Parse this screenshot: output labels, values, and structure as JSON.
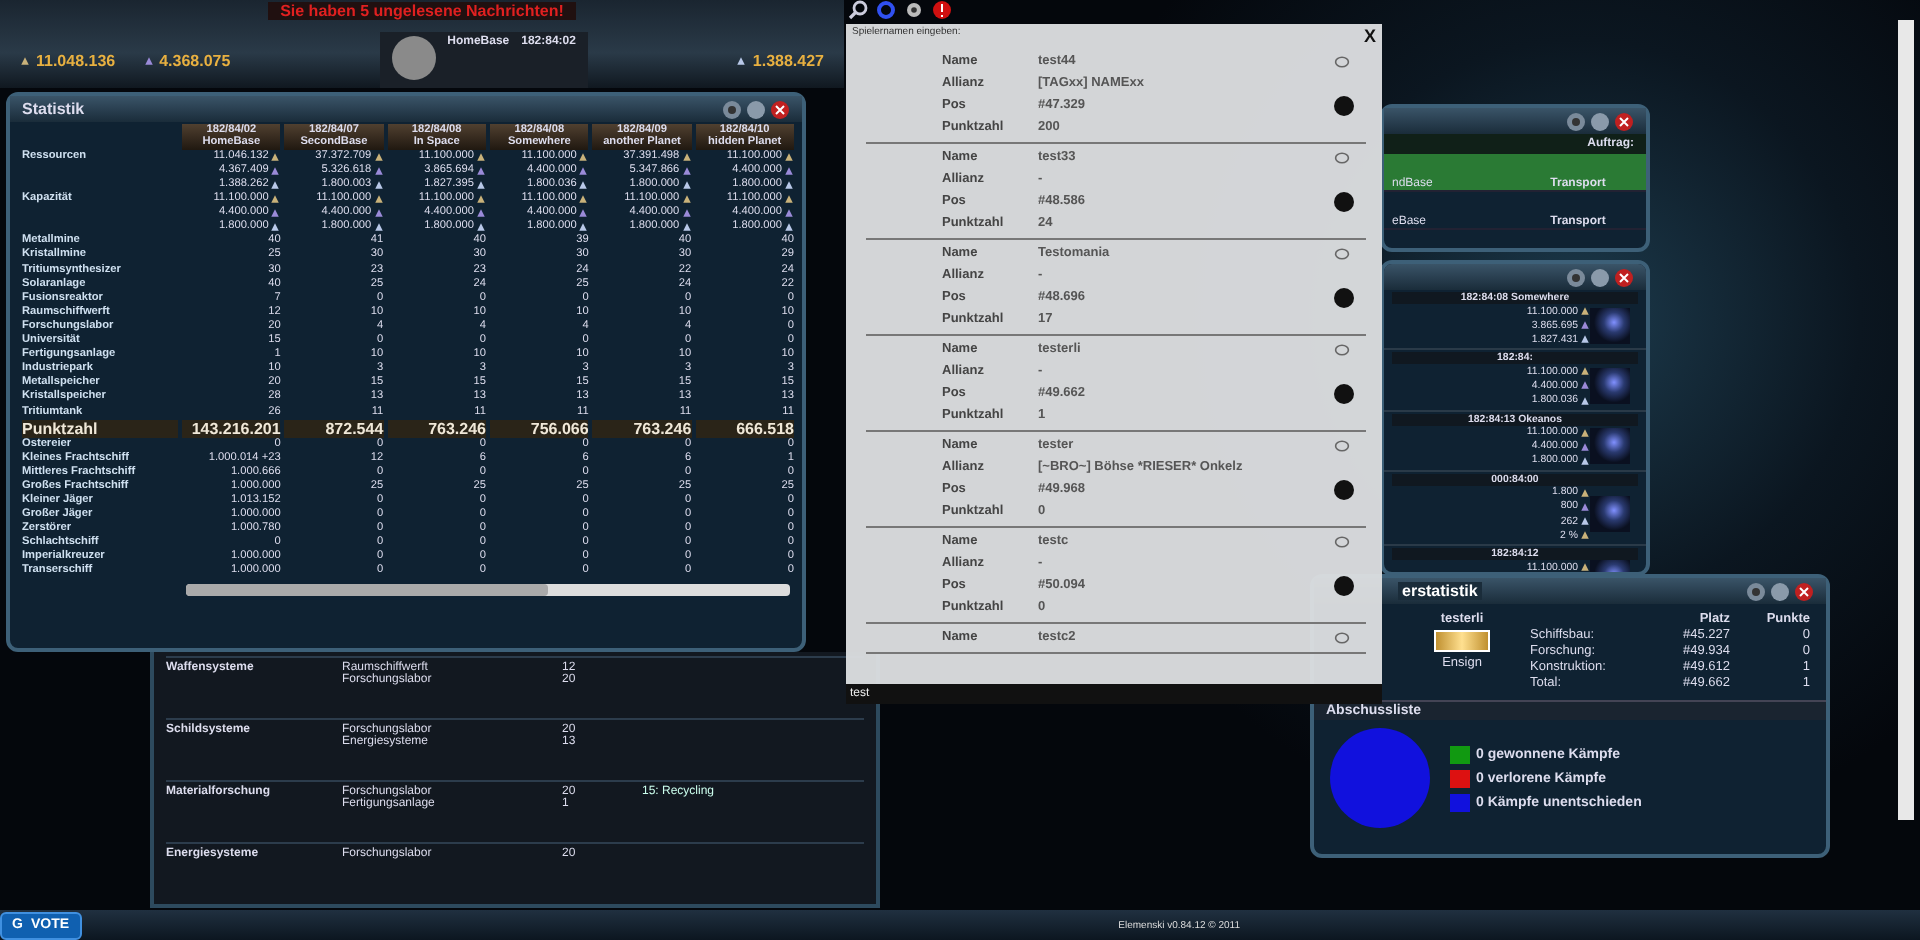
{
  "top_bar": {
    "message": "Sie haben 5 ungelesene Nachrichten!",
    "resources": [
      {
        "kind": "metal",
        "value": "11.048.136"
      },
      {
        "kind": "crystal",
        "value": "4.368.075"
      },
      {
        "kind": "tritium",
        "value": "1.388.427"
      }
    ],
    "planet": {
      "name": "HomeBase",
      "coords": "182:84:02"
    }
  },
  "statistik": {
    "title": "Statistik",
    "columns": [
      {
        "date": "182/84/02",
        "name": "HomeBase"
      },
      {
        "date": "182/84/07",
        "name": "SecondBase"
      },
      {
        "date": "182/84/08",
        "name": "In Space"
      },
      {
        "date": "182/84/08",
        "name": "Somewhere"
      },
      {
        "date": "182/84/09",
        "name": "another Planet"
      },
      {
        "date": "182/84/10",
        "name": "hidden Planet"
      }
    ],
    "resources": {
      "label": "Ressourcen",
      "rows": [
        [
          "11.046.132",
          "37.372.709",
          "11.100.000",
          "11.100.000",
          "37.391.498",
          "11.100.000"
        ],
        [
          "4.367.409",
          "5.326.618",
          "3.865.694",
          "4.400.000",
          "5.347.866",
          "4.400.000"
        ],
        [
          "1.388.262",
          "1.800.003",
          "1.827.395",
          "1.800.036",
          "1.800.000",
          "1.800.000"
        ]
      ]
    },
    "capacity": {
      "label": "Kapazität",
      "rows": [
        [
          "11.100.000",
          "11.100.000",
          "11.100.000",
          "11.100.000",
          "11.100.000",
          "11.100.000"
        ],
        [
          "4.400.000",
          "4.400.000",
          "4.400.000",
          "4.400.000",
          "4.400.000",
          "4.400.000"
        ],
        [
          "1.800.000",
          "1.800.000",
          "1.800.000",
          "1.800.000",
          "1.800.000",
          "1.800.000"
        ]
      ]
    },
    "buildings": [
      {
        "label": "Metallmine",
        "values": [
          "40",
          "41",
          "40",
          "39",
          "40",
          "40"
        ]
      },
      {
        "label": "Kristallmine",
        "values": [
          "25",
          "30",
          "30",
          "30",
          "30",
          "29"
        ]
      },
      {
        "label": "Tritiumsynthesizer",
        "values": [
          "30",
          "23",
          "23",
          "24",
          "22",
          "24"
        ]
      },
      {
        "label": "Solaranlage",
        "values": [
          "40",
          "25",
          "24",
          "25",
          "24",
          "22"
        ]
      },
      {
        "label": "Fusionsreaktor",
        "values": [
          "7",
          "0",
          "0",
          "0",
          "0",
          "0"
        ]
      },
      {
        "label": "Raumschiffwerft",
        "values": [
          "12",
          "10",
          "10",
          "10",
          "10",
          "10"
        ]
      },
      {
        "label": "Forschungslabor",
        "values": [
          "20",
          "4",
          "4",
          "4",
          "4",
          "0"
        ]
      },
      {
        "label": "Universität",
        "values": [
          "15",
          "0",
          "0",
          "0",
          "0",
          "0"
        ]
      },
      {
        "label": "Fertigungsanlage",
        "values": [
          "1",
          "10",
          "10",
          "10",
          "10",
          "10"
        ]
      },
      {
        "label": "Industriepark",
        "values": [
          "10",
          "3",
          "3",
          "3",
          "3",
          "3"
        ]
      },
      {
        "label": "Metallspeicher",
        "values": [
          "20",
          "15",
          "15",
          "15",
          "15",
          "15"
        ]
      },
      {
        "label": "Kristallspeicher",
        "values": [
          "28",
          "13",
          "13",
          "13",
          "13",
          "13"
        ]
      },
      {
        "label": "Tritiumtank",
        "values": [
          "26",
          "11",
          "11",
          "11",
          "11",
          "11"
        ]
      }
    ],
    "total": {
      "label": "Punktzahl",
      "values": [
        "143.216.201",
        "872.544",
        "763.246",
        "756.066",
        "763.246",
        "666.518"
      ]
    },
    "ships": [
      {
        "label": "Ostereier",
        "values": [
          "0",
          "0",
          "0",
          "0",
          "0",
          "0"
        ]
      },
      {
        "label": "Kleines Frachtschiff",
        "values": [
          "1.000.014 +23",
          "12",
          "6",
          "6",
          "6",
          "1"
        ]
      },
      {
        "label": "Mittleres Frachtschiff",
        "values": [
          "1.000.666",
          "0",
          "0",
          "0",
          "0",
          "0"
        ]
      },
      {
        "label": "Großes Frachtschiff",
        "values": [
          "1.000.000",
          "25",
          "25",
          "25",
          "25",
          "25"
        ]
      },
      {
        "label": "Kleiner Jäger",
        "values": [
          "1.013.152",
          "0",
          "0",
          "0",
          "0",
          "0"
        ]
      },
      {
        "label": "Großer Jäger",
        "values": [
          "1.000.000",
          "0",
          "0",
          "0",
          "0",
          "0"
        ]
      },
      {
        "label": "Zerstörer",
        "values": [
          "1.000.780",
          "0",
          "0",
          "0",
          "0",
          "0"
        ]
      },
      {
        "label": "Schlachtschiff",
        "values": [
          "0",
          "0",
          "0",
          "0",
          "0",
          "0"
        ]
      },
      {
        "label": "Imperialkreuzer",
        "values": [
          "1.000.000",
          "0",
          "0",
          "0",
          "0",
          "0"
        ]
      },
      {
        "label": "Transerschiff",
        "values": [
          "1.000.000",
          "0",
          "0",
          "0",
          "0",
          "0"
        ]
      }
    ]
  },
  "research": [
    {
      "title": "Waffensysteme",
      "requirements": [
        {
          "name": "Raumschiffwerft",
          "level": "12"
        },
        {
          "name": "Forschungslabor",
          "level": "20"
        }
      ]
    },
    {
      "title": "Schildsysteme",
      "requirements": [
        {
          "name": "Forschungslabor",
          "level": "20"
        },
        {
          "name": "Energiesysteme",
          "level": "13"
        }
      ]
    },
    {
      "title": "Materialforschung",
      "requirements": [
        {
          "name": "Forschungslabor",
          "level": "20"
        },
        {
          "name": "Fertigungsanlage",
          "level": "1"
        }
      ],
      "unlocks": [
        "15: Recycling"
      ]
    },
    {
      "title": "Energiesysteme",
      "requirements": [
        {
          "name": "Forschungslabor",
          "level": "20"
        }
      ]
    }
  ],
  "player_search": {
    "title": "Spielernamen eingeben:",
    "close": "X",
    "value": "test",
    "players": [
      {
        "fields": [
          {
            "label": "Name",
            "value": "test44"
          },
          {
            "label": "Allianz",
            "value": "[TAGxx] NAMExx"
          },
          {
            "label": "Pos",
            "value": "#47.329"
          },
          {
            "label": "Punktzahl",
            "value": "200"
          }
        ]
      },
      {
        "fields": [
          {
            "label": "Name",
            "value": "test33"
          },
          {
            "label": "Allianz",
            "value": "-"
          },
          {
            "label": "Pos",
            "value": "#48.586"
          },
          {
            "label": "Punktzahl",
            "value": "24"
          }
        ]
      },
      {
        "fields": [
          {
            "label": "Name",
            "value": "Testomania"
          },
          {
            "label": "Allianz",
            "value": "-"
          },
          {
            "label": "Pos",
            "value": "#48.696"
          },
          {
            "label": "Punktzahl",
            "value": "17"
          }
        ]
      },
      {
        "fields": [
          {
            "label": "Name",
            "value": "testerli"
          },
          {
            "label": "Allianz",
            "value": "-"
          },
          {
            "label": "Pos",
            "value": "#49.662"
          },
          {
            "label": "Punktzahl",
            "value": "1"
          }
        ]
      },
      {
        "fields": [
          {
            "label": "Name",
            "value": "tester"
          },
          {
            "label": "Allianz",
            "value": "[~BRO~] Böhse *RIESER* Onkelz"
          },
          {
            "label": "Pos",
            "value": "#49.968"
          },
          {
            "label": "Punktzahl",
            "value": "0"
          }
        ]
      },
      {
        "fields": [
          {
            "label": "Name",
            "value": "testc"
          },
          {
            "label": "Allianz",
            "value": "-"
          },
          {
            "label": "Pos",
            "value": "#50.094"
          },
          {
            "label": "Punktzahl",
            "value": "0"
          }
        ]
      },
      {
        "fields": [
          {
            "label": "Name",
            "value": "testc2"
          }
        ]
      }
    ]
  },
  "fleet": {
    "header": "Auftrag:",
    "rows": [
      {
        "target": "ndBase",
        "mission": "Transport",
        "selected": true
      },
      {
        "target": "eBase",
        "mission": "Transport",
        "selected": false
      }
    ]
  },
  "planets": [
    {
      "header": "182:84:08 Somewhere",
      "values": [
        "11.100.000",
        "3.865.695",
        "1.827.431"
      ]
    },
    {
      "header": "182:84:",
      "values": [
        "11.100.000",
        "4.400.000",
        "1.800.036"
      ]
    },
    {
      "header": "182:84:13 Okeanos",
      "values": [
        "11.100.000",
        "4.400.000",
        "1.800.000"
      ]
    },
    {
      "header": "000:84:00",
      "values": [
        "1.800",
        "800",
        "262",
        "2 %"
      ]
    },
    {
      "header": "182:84:12",
      "values": [
        "11.100.000"
      ]
    }
  ],
  "user_stats": {
    "title": "erstatistik",
    "name": "testerli",
    "rank": "Ensign",
    "headers": [
      "Platz",
      "Punkte"
    ],
    "rows": [
      {
        "label": "Schiffsbau:",
        "place": "#45.227",
        "points": "0"
      },
      {
        "label": "Forschung:",
        "place": "#49.934",
        "points": "0"
      },
      {
        "label": "Konstruktion:",
        "place": "#49.612",
        "points": "1"
      },
      {
        "label": "Total:",
        "place": "#49.662",
        "points": "1"
      }
    ],
    "kills_title": "Abschussliste",
    "legend": [
      {
        "label": "0 gewonnene Kämpfe",
        "color": "#119911"
      },
      {
        "label": "0 verlorene Kämpfe",
        "color": "#dd1111"
      },
      {
        "label": "0 Kämpfe unentschieden",
        "color": "#1111dd"
      }
    ]
  },
  "footer": {
    "vote": "VOTE",
    "vote_letter": "G",
    "version": "Elemenski v0.84.12 © 2011"
  }
}
